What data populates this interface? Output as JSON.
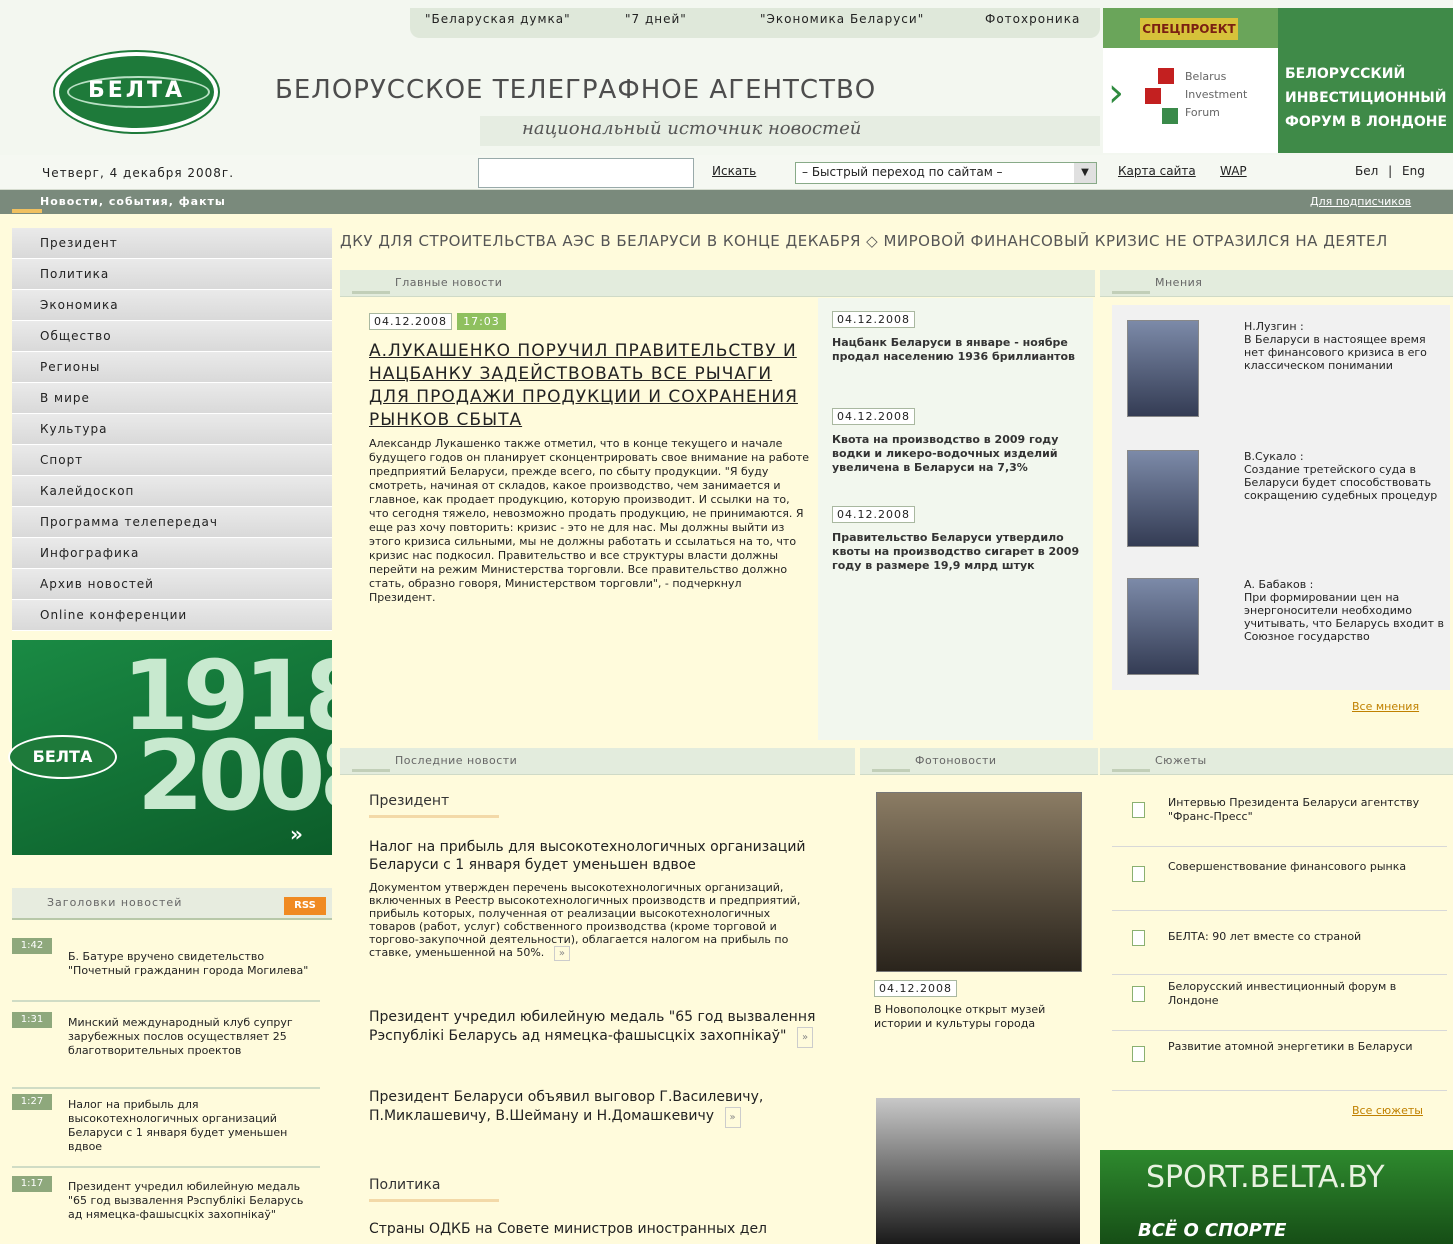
{
  "top_links": [
    "\"Беларуская думка\"",
    "\"7 дней\"",
    "\"Экономика Беларуси\"",
    "Фотохроника"
  ],
  "logo": {
    "text": "БЕЛТА"
  },
  "agency": {
    "title": "БЕЛОРУССКОЕ ТЕЛЕГРАФНОЕ АГЕНТСТВО",
    "subtitle": "национальный источник новостей"
  },
  "banner": {
    "badge": "СПЕЦПРОЕКТ",
    "forum_lines": "Belarus\nInvestment\nForum",
    "text": [
      "БЕЛОРУССКИЙ",
      "ИНВЕСТИЦИОННЫЙ",
      "ФОРУМ В ЛОНДОНЕ"
    ]
  },
  "infobar": {
    "date": "Четверг, 4 декабря 2008г.",
    "search_label": "Искать",
    "quick_jump": "– Быстрый переход по сайтам –",
    "sitemap": "Карта сайта",
    "wap": "WAP",
    "lang_bel": "Бел",
    "lang_sep": "|",
    "lang_eng": "Eng"
  },
  "greenbar": {
    "label": "Новости, события, факты",
    "subscribers": "Для подписчиков"
  },
  "nav": [
    "Президент",
    "Политика",
    "Экономика",
    "Общество",
    "Регионы",
    "В мире",
    "Культура",
    "Спорт",
    "Калейдоскоп",
    "Программа телепередач",
    "Инфографика",
    "Архив новостей",
    "Online конференции"
  ],
  "promo": {
    "year_top": "1918",
    "year_bottom": "2008",
    "logo": "БЕЛТА",
    "arrow": "»"
  },
  "headings": {
    "title": "Заголовки новостей",
    "rss": "RSS",
    "items": [
      {
        "time": "1:42",
        "text": "Б. Батуре вручено свидетельство \"Почетный гражданин города Могилева\""
      },
      {
        "time": "1:31",
        "text": "Минский международный клуб супруг зарубежных послов осуществляет 25 благотворительных проектов"
      },
      {
        "time": "1:27",
        "text": "Налог на прибыль для высокотехнологичных организаций Беларуси с 1 января будет уменьшен вдвое"
      },
      {
        "time": "1:17",
        "text": "Президент учредил юбилейную медаль \"65 год вызвалення Рэспублiкi Беларусь ад нямецка-фашысцкiх захопнiкаў\""
      }
    ]
  },
  "ticker": "ДКУ ДЛЯ СТРОИТЕЛЬСТВА АЭС В БЕЛАРУСИ В КОНЦЕ ДЕКАБРЯ  ◇  МИРОВОЙ ФИНАНСОВЫЙ КРИЗИС НЕ ОТРАЗИЛСЯ НА ДЕЯТЕЛ",
  "main_news": {
    "header": "Главные новости",
    "date": "04.12.2008",
    "time": "17:03",
    "title": "А.ЛУКАШЕНКО ПОРУЧИЛ ПРАВИТЕЛЬСТВУ И НАЦБАНКУ ЗАДЕЙСТВОВАТЬ ВСЕ РЫЧАГИ ДЛЯ ПРОДАЖИ ПРОДУКЦИИ И СОХРАНЕНИЯ РЫНКОВ СБЫТА",
    "text": "Александр Лукашенко также отметил, что в конце текущего и начале будущего годов он планирует сконцентрировать свое внимание на работе предприятий Беларуси, прежде всего, по сбыту продукции. \"Я буду смотреть, начиная от складов, какое производство, чем занимается и главное, как продает продукцию, которую производит. И ссылки на то, что сегодня тяжело, невозможно продать продукцию, не принимаются. Я еще раз хочу повторить: кризис - это не для нас. Мы должны выйти из этого кризиса сильными, мы не должны работать и ссылаться на то, что кризис нас подкосил. Правительство и все структуры власти должны перейти на режим Министерства торговли. Все правительство должно стать, образно говоря, Министерством торговли\", - подчеркнул Президент."
  },
  "side_news": [
    {
      "date": "04.12.2008",
      "text": "Нацбанк Беларуси в январе - ноябре продал населению 1936 бриллиантов"
    },
    {
      "date": "04.12.2008",
      "text": "Квота на производство в 2009 году водки и ликеро-водочных изделий увеличена в Беларуси на 7,3%"
    },
    {
      "date": "04.12.2008",
      "text": "Правительство Беларуси утвердило квоты на производство сигарет в 2009 году в размере 19,9 млрд штук"
    }
  ],
  "opinions": {
    "header": "Мнения",
    "items": [
      {
        "name": "Н.Лузгин :",
        "text": "В Беларуси в настоящее время нет финансового кризиса в его классическом понимании"
      },
      {
        "name": "В.Сукало :",
        "text": "Создание третейского суда в Беларуси будет способствовать сокращению судебных процедур"
      },
      {
        "name": "А. Бабаков :",
        "text": "При формировании цен на энергоносители необходимо учитывать, что Беларусь входит в Союзное государство"
      }
    ],
    "more": "Все мнения"
  },
  "latest": {
    "header": "Последние новости",
    "category1": "Президент",
    "lead": "Налог на прибыль для высокотехнологичных организаций Беларуси с 1 января будет уменьшен вдвое",
    "body": "Документом утвержден перечень высокотехнологичных организаций, включенных в Реестр высокотехнологичных производств и предприятий, прибыль которых, полученная от реализации высокотехнологичных товаров (работ, услуг) собственного производства (кроме торговой и торгово-закупочной деятельности), облагается налогом на прибыль по ставке, уменьшенной на 50%.",
    "items": [
      "Президент учредил юбилейную медаль \"65 год вызвалення Рэспублiкi Беларусь ад нямецка-фашысцкiх захопнiкаў\"",
      "Президент Беларуси объявил выговор Г.Василевичу, П.Миклашевичу, В.Шейману и Н.Домашкевичу"
    ],
    "arrow": "»",
    "category2": "Политика",
    "last": "Страны ОДКБ на Совете министров иностранных дел"
  },
  "photo_news": {
    "header": "Фотоновости",
    "date": "04.12.2008",
    "text": "В Новополоцке открыт музей истории и культуры города"
  },
  "stories": {
    "header": "Сюжеты",
    "items": [
      "Интервью Президента Беларуси агентству \"Франс-Пресс\"",
      "Совершенствование финансового рынка",
      "БЕЛТА: 90 лет вместе со страной",
      "Белорусский инвестиционный форум в Лондоне",
      "Развитие атомной энергетики в Беларуси"
    ],
    "more": "Все сюжеты"
  },
  "sport": {
    "title": "SPORT.BELTA.BY",
    "subtitle": "ВСЁ О СПОРТЕ"
  }
}
